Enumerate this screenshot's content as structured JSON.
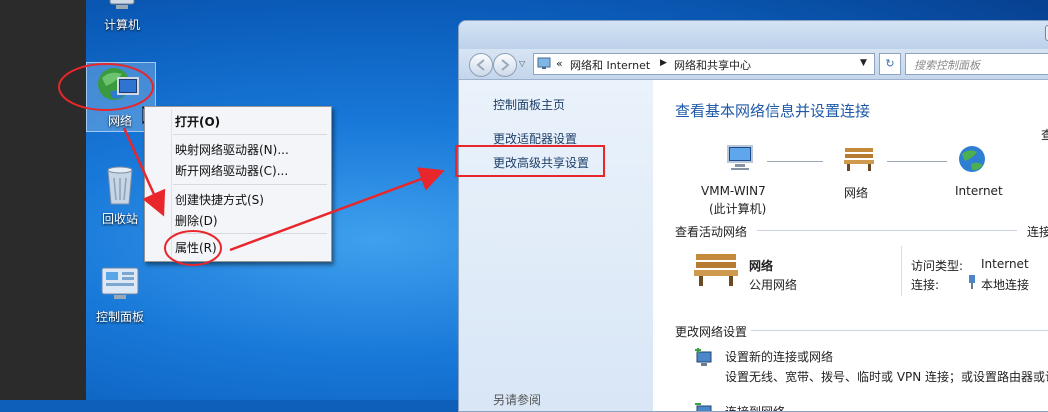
{
  "desktop": {
    "icons": [
      {
        "label": "计算机",
        "icon": "computer-icon"
      },
      {
        "label": "网络",
        "icon": "network-globe-icon"
      },
      {
        "label": "回收站",
        "icon": "recycle-bin-icon"
      },
      {
        "label": "控制面板",
        "icon": "control-panel-icon"
      }
    ]
  },
  "context_menu": {
    "items": [
      {
        "label": "打开(O)"
      },
      {
        "label": "映射网络驱动器(N)..."
      },
      {
        "label": "断开网络驱动器(C)..."
      },
      {
        "label": "创建快捷方式(S)"
      },
      {
        "label": "删除(D)"
      },
      {
        "label": "属性(R)"
      }
    ]
  },
  "window": {
    "address": {
      "separator": "«",
      "crumbs": [
        "网络和 Internet",
        "网络和共享中心"
      ]
    },
    "search_placeholder": "搜索控制面板",
    "sidebar": {
      "links": [
        "控制面板主页",
        "更改适配器设置",
        "更改高级共享设置"
      ],
      "see_also": "另请参阅"
    },
    "main": {
      "title": "查看基本网络信息并设置连接",
      "corner_link": "查",
      "nodes": [
        {
          "label": "VMM-WIN7",
          "sublabel": "(此计算机)"
        },
        {
          "label": "网络"
        },
        {
          "label": "Internet"
        }
      ],
      "active_networks": {
        "heading": "查看活动网络",
        "corner_link": "连接",
        "network_name": "网络",
        "network_type": "公用网络",
        "access_type_label": "访问类型:",
        "access_type_value": "Internet",
        "connections_label": "连接:",
        "connections_value": "本地连接"
      },
      "change_settings": {
        "heading": "更改网络设置",
        "items": [
          {
            "title": "设置新的连接或网络",
            "description": "设置无线、宽带、拨号、临时或 VPN 连接；或设置路由器或访"
          },
          {
            "title": "连接到网络"
          }
        ]
      }
    }
  },
  "colors": {
    "annotation_red": "#e8262b",
    "link_blue": "#1b56b3",
    "title_blue": "#1e5aa8"
  }
}
